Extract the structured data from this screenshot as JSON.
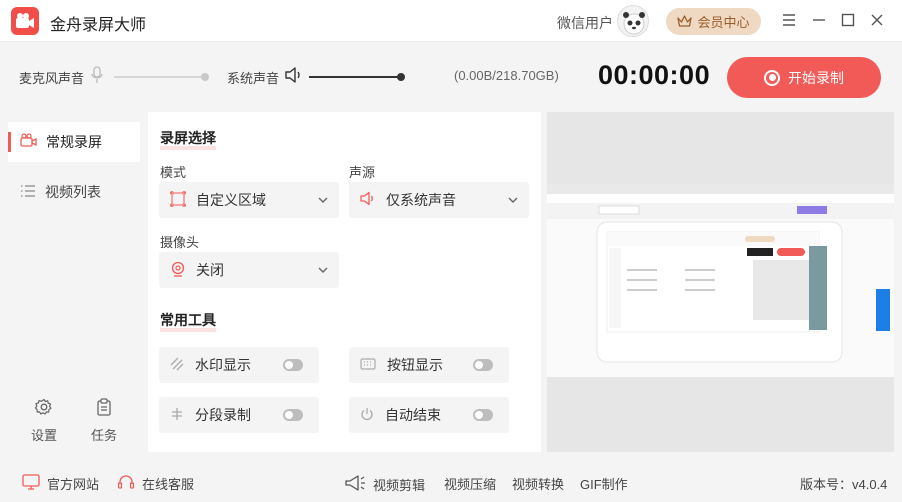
{
  "app": {
    "title": "金舟录屏大师"
  },
  "header": {
    "user_name": "微信用户",
    "member_label": "会员中心"
  },
  "toolbar": {
    "mic_label": "麦克风声音",
    "system_label": "系统声音",
    "mic_level": 0,
    "system_level": 1.0,
    "storage": "(0.00B/218.70GB)",
    "timer": "00:00:00",
    "record_button": "开始录制"
  },
  "sidebar": {
    "items": [
      {
        "label": "常规录屏",
        "icon": "video-camera-icon",
        "active": true
      },
      {
        "label": "视频列表",
        "icon": "list-icon",
        "active": false
      }
    ],
    "tools": [
      {
        "label": "设置",
        "icon": "gear-icon"
      },
      {
        "label": "任务",
        "icon": "clipboard-icon"
      }
    ]
  },
  "panel": {
    "screen_section": "录屏选择",
    "mode_label": "模式",
    "mode_value": "自定义区域",
    "audio_label": "声源",
    "audio_value": "仅系统声音",
    "camera_label": "摄像头",
    "camera_value": "关闭",
    "tools_section": "常用工具",
    "tools": [
      {
        "label": "水印显示",
        "icon": "watermark-icon",
        "on": false
      },
      {
        "label": "按钮显示",
        "icon": "keyboard-icon",
        "on": false
      },
      {
        "label": "分段录制",
        "icon": "segment-icon",
        "on": false
      },
      {
        "label": "自动结束",
        "icon": "power-icon",
        "on": false
      }
    ]
  },
  "footer": {
    "website": "官方网站",
    "support": "在线客服",
    "video_edit": "视频剪辑",
    "video_compress": "视频压缩",
    "video_convert": "视频转换",
    "gif_make": "GIF制作",
    "version": "版本号：v4.0.4"
  },
  "colors": {
    "accent": "#f15a57",
    "member_bg": "#efd9c3",
    "panel_bg": "#f4f4f4"
  }
}
